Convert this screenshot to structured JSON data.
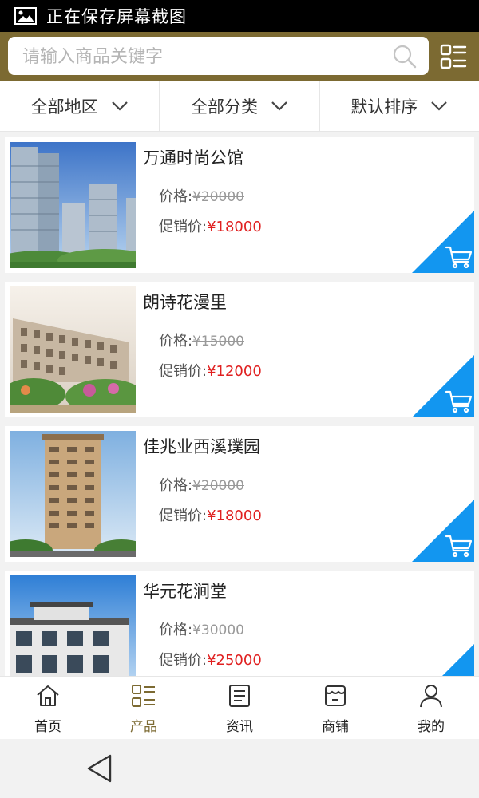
{
  "status_bar": {
    "text": "正在保存屏幕截图",
    "icon": "image-icon"
  },
  "search": {
    "placeholder": "请输入商品关键字",
    "value": "",
    "icon": "search-icon"
  },
  "header": {
    "menu_icon": "list-menu-icon"
  },
  "filters": [
    {
      "label": "全部地区",
      "icon": "chevron-down-icon"
    },
    {
      "label": "全部分类",
      "icon": "chevron-down-icon"
    },
    {
      "label": "默认排序",
      "icon": "chevron-down-icon"
    }
  ],
  "products": [
    {
      "name": "万通时尚公馆",
      "price_label": "价格:",
      "price": "¥20000",
      "promo_label": "促销价:",
      "promo_price": "¥18000"
    },
    {
      "name": "朗诗花漫里",
      "price_label": "价格:",
      "price": "¥15000",
      "promo_label": "促销价:",
      "promo_price": "¥12000"
    },
    {
      "name": "佳兆业西溪璞园",
      "price_label": "价格:",
      "price": "¥20000",
      "promo_label": "促销价:",
      "promo_price": "¥18000"
    },
    {
      "name": "华元花涧堂",
      "price_label": "价格:",
      "price": "¥30000",
      "promo_label": "促销价:",
      "promo_price": "¥25000"
    }
  ],
  "nav": [
    {
      "label": "首页",
      "icon": "home-icon",
      "active": false
    },
    {
      "label": "产品",
      "icon": "product-list-icon",
      "active": true
    },
    {
      "label": "资讯",
      "icon": "news-icon",
      "active": false
    },
    {
      "label": "商铺",
      "icon": "shop-icon",
      "active": false
    },
    {
      "label": "我的",
      "icon": "user-icon",
      "active": false
    }
  ],
  "colors": {
    "brand": "#7c6a32",
    "accent_blue": "#1296f0",
    "promo_red": "#e02020"
  }
}
